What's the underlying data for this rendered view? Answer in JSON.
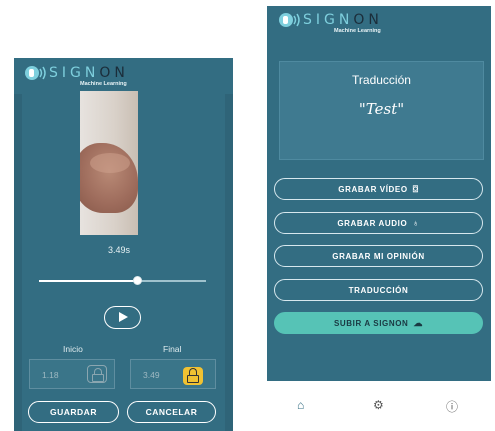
{
  "brand": {
    "name_light": "SIGN",
    "name_dark": "ON",
    "tagline": "Machine Learning"
  },
  "recorder": {
    "duration_label": "3.49s",
    "progress_fraction": 0.59,
    "start_label": "Inicio",
    "end_label": "Final",
    "start_value": "1.18",
    "end_value": "3.49",
    "save_label": "GUARDAR",
    "cancel_label": "CANCELAR"
  },
  "translation": {
    "title": "Traducción",
    "text": "\"Test\""
  },
  "actions": [
    {
      "label": "GRABAR VÍDEO",
      "icon": "camera-icon",
      "glyph": "⌼"
    },
    {
      "label": "GRABAR AUDIO",
      "icon": "microphone-icon",
      "glyph": "♁"
    },
    {
      "label": "GRABAR MI OPINIÓN",
      "icon": "",
      "glyph": ""
    },
    {
      "label": "TRADUCCIÓN",
      "icon": "",
      "glyph": ""
    },
    {
      "label": "SUBIR A SIGNON",
      "icon": "cloud-upload-icon",
      "glyph": "☁"
    }
  ],
  "nav": [
    {
      "icon": "home-icon",
      "glyph": "⌂"
    },
    {
      "icon": "settings-icon",
      "glyph": "⚙"
    },
    {
      "icon": "info-icon",
      "glyph": "ⓘ"
    }
  ],
  "colors": {
    "primary": "#336d82",
    "accent": "#56c3b6",
    "lock_active": "#f1c232"
  }
}
